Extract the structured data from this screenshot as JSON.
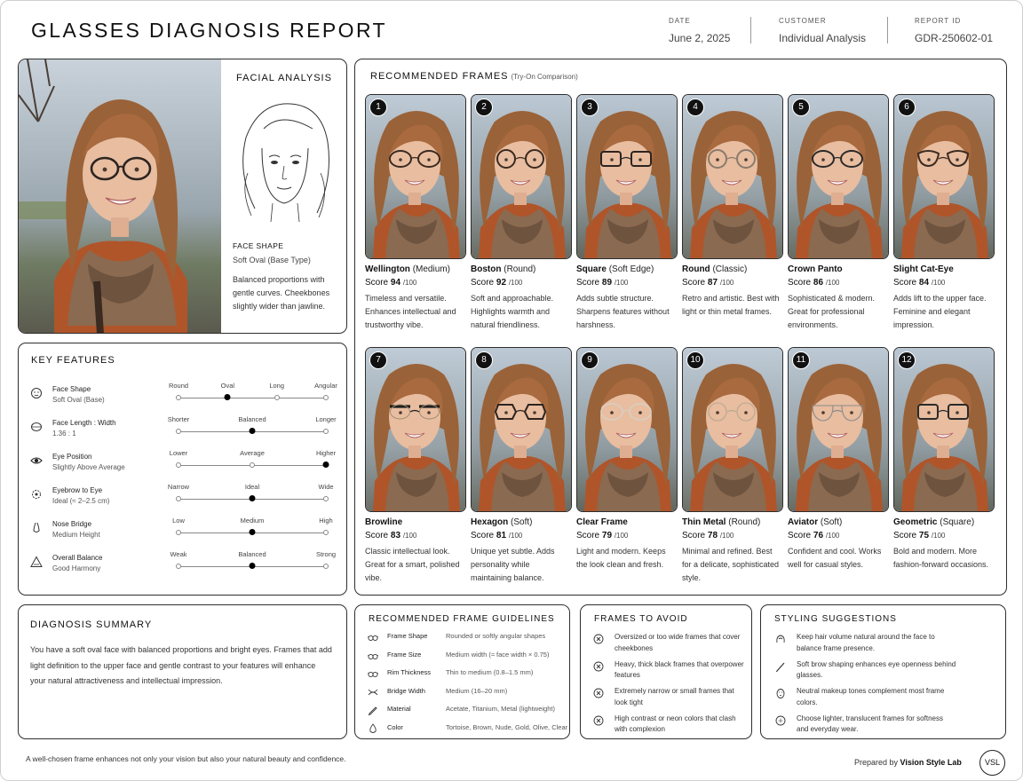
{
  "header": {
    "title": "GLASSES DIAGNOSIS REPORT",
    "date_label": "DATE",
    "date_value": "June 2, 2025",
    "customer_label": "CUSTOMER",
    "customer_value": "Individual Analysis",
    "report_label": "REPORT ID",
    "report_value": "GDR-250602-01"
  },
  "facial_analysis": {
    "title": "FACIAL ANALYSIS",
    "face_shape_label": "FACE SHAPE",
    "face_shape_value": "Soft Oval (Base Type)",
    "description": "Balanced proportions with gentle curves. Cheekbones slightly wider than jawline."
  },
  "key_features": {
    "title": "KEY FEATURES",
    "rows": [
      {
        "icon": "face-outline-icon",
        "name": "Face Shape",
        "value": "Soft Oval (Base)",
        "scale": [
          "Round",
          "Oval",
          "Long",
          "Angular"
        ],
        "selected": 1
      },
      {
        "icon": "face-ratio-icon",
        "name": "Face Length : Width",
        "value": "1.36 : 1",
        "scale": [
          "Shorter",
          "Balanced",
          "Longer"
        ],
        "selected": 1
      },
      {
        "icon": "eye-icon",
        "name": "Eye Position",
        "value": "Slightly Above Average",
        "scale": [
          "Lower",
          "Average",
          "Higher"
        ],
        "selected": 2
      },
      {
        "icon": "eyebrow-target-icon",
        "name": "Eyebrow to Eye",
        "value": "Ideal (≈ 2–2.5 cm)",
        "scale": [
          "Narrow",
          "Ideal",
          "Wide"
        ],
        "selected": 1
      },
      {
        "icon": "nose-icon",
        "name": "Nose Bridge",
        "value": "Medium Height",
        "scale": [
          "Low",
          "Medium",
          "High"
        ],
        "selected": 1
      },
      {
        "icon": "balance-triangle-icon",
        "name": "Overall Balance",
        "value": "Good Harmony",
        "scale": [
          "Weak",
          "Balanced",
          "Strong"
        ],
        "selected": 1
      }
    ]
  },
  "recommended": {
    "title": "RECOMMENDED FRAMES",
    "subtitle": "(Try-On Comparison)",
    "score_max": "/100",
    "score_prefix": "Score",
    "frames": [
      {
        "num": "1",
        "name": "Wellington",
        "variant": "(Medium)",
        "score": "94",
        "desc": "Timeless and versatile. Enhances intellectual and trustworthy vibe.",
        "frame_color": "#3a2a20",
        "frame_style": "wellington"
      },
      {
        "num": "2",
        "name": "Boston",
        "variant": "(Round)",
        "score": "92",
        "desc": "Soft and approachable. Highlights warmth and natural friendliness.",
        "frame_color": "#3a2a20",
        "frame_style": "boston"
      },
      {
        "num": "3",
        "name": "Square",
        "variant": "(Soft Edge)",
        "score": "89",
        "desc": "Adds subtle structure. Sharpens features without harshness.",
        "frame_color": "#2d2420",
        "frame_style": "square"
      },
      {
        "num": "4",
        "name": "Round",
        "variant": "(Classic)",
        "score": "87",
        "desc": "Retro and artistic. Best with light or thin metal frames.",
        "frame_color": "#8a7a6a",
        "frame_style": "round"
      },
      {
        "num": "5",
        "name": "Crown Panto",
        "variant": "",
        "score": "86",
        "desc": "Sophisticated & modern. Great for professional environments.",
        "frame_color": "#2a2a2a",
        "frame_style": "panto"
      },
      {
        "num": "6",
        "name": "Slight Cat-Eye",
        "variant": "",
        "score": "84",
        "desc": "Adds lift to the upper face. Feminine and elegant impression.",
        "frame_color": "#3a2a20",
        "frame_style": "cateye"
      },
      {
        "num": "7",
        "name": "Browline",
        "variant": "",
        "score": "83",
        "desc": "Classic intellectual look. Great for a smart, polished vibe.",
        "frame_color": "#1e1e1e",
        "frame_style": "browline"
      },
      {
        "num": "8",
        "name": "Hexagon",
        "variant": "(Soft)",
        "score": "81",
        "desc": "Unique yet subtle. Adds personality while maintaining balance.",
        "frame_color": "#2d2420",
        "frame_style": "hexagon"
      },
      {
        "num": "9",
        "name": "Clear Frame",
        "variant": "",
        "score": "79",
        "desc": "Light and modern. Keeps the look clean and fresh.",
        "frame_color": "#d8cfc4",
        "frame_style": "clear"
      },
      {
        "num": "10",
        "name": "Thin Metal",
        "variant": "(Round)",
        "score": "78",
        "desc": "Minimal and refined. Best for a delicate, sophisticated style.",
        "frame_color": "#b8a890",
        "frame_style": "thin"
      },
      {
        "num": "11",
        "name": "Aviator",
        "variant": "(Soft)",
        "score": "76",
        "desc": "Confident and cool. Works well for casual styles.",
        "frame_color": "#8a8a8a",
        "frame_style": "aviator"
      },
      {
        "num": "12",
        "name": "Geometric",
        "variant": "(Square)",
        "score": "75",
        "desc": "Bold and modern. More fashion-forward occasions.",
        "frame_color": "#2a2a2a",
        "frame_style": "geometric"
      }
    ]
  },
  "summary": {
    "title": "DIAGNOSIS SUMMARY",
    "body": "You have a soft oval face with balanced proportions and bright eyes. Frames that add light definition to the upper face and gentle contrast to your features will enhance your natural attractiveness and intellectual impression."
  },
  "guidelines": {
    "title": "RECOMMENDED FRAME GUIDELINES",
    "rows": [
      {
        "icon": "glasses-icon",
        "label": "Frame Shape",
        "value": "Rounded or softly angular shapes"
      },
      {
        "icon": "glasses-icon",
        "label": "Frame Size",
        "value": "Medium width (≈ face width × 0.75)"
      },
      {
        "icon": "glasses-icon",
        "label": "Rim Thickness",
        "value": "Thin to medium (0.8–1.5 mm)"
      },
      {
        "icon": "bridge-icon",
        "label": "Bridge Width",
        "value": "Medium (16–20 mm)"
      },
      {
        "icon": "pencil-icon",
        "label": "Material",
        "value": "Acetate, Titanium, Metal (lightweight)"
      },
      {
        "icon": "color-drop-icon",
        "label": "Color",
        "value": "Tortoise, Brown, Nude, Gold, Olive, Clear"
      }
    ]
  },
  "avoid": {
    "title": "FRAMES TO AVOID",
    "items": [
      "Oversized or too wide frames that cover cheekbones",
      "Heavy, thick black frames that overpower features",
      "Extremely narrow or small frames that look tight",
      "High contrast or neon colors that clash with complexion"
    ]
  },
  "styling": {
    "title": "STYLING SUGGESTIONS",
    "items": [
      {
        "icon": "hair-icon",
        "text": "Keep hair volume natural around the face to balance frame presence."
      },
      {
        "icon": "brow-pencil-icon",
        "text": "Soft brow shaping enhances eye openness behind glasses."
      },
      {
        "icon": "makeup-icon",
        "text": "Neutral makeup tones complement most frame colors."
      },
      {
        "icon": "sparkle-icon",
        "text": "Choose lighter, translucent frames for softness and everyday wear."
      }
    ]
  },
  "footer": {
    "note": "A well-chosen frame enhances not only your vision but also your natural beauty and confidence.",
    "prepared_by": "Prepared by",
    "brand": "Vision Style Lab",
    "logo": "VSL"
  },
  "colors": {
    "ink": "#1c1c1c",
    "hair": "#9a6238",
    "scarf": "#7a5a44",
    "jacket": "#b0552a",
    "skin": "#e8bda0",
    "sky": "#b9c6d2"
  }
}
